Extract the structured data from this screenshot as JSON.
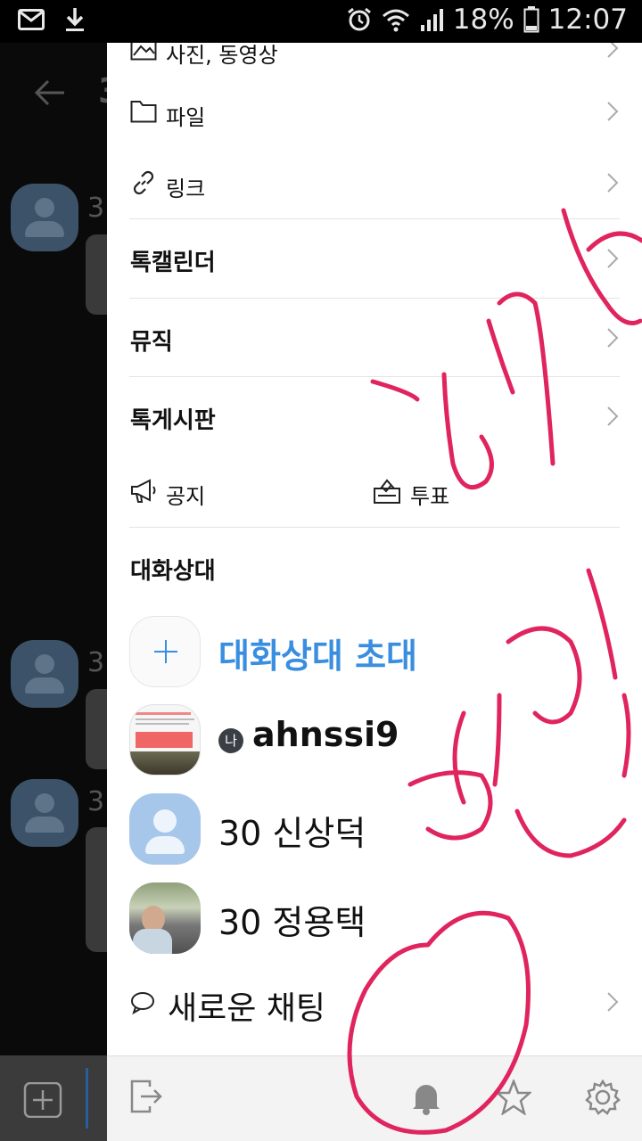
{
  "status_bar": {
    "battery": "18%",
    "time": "12:07"
  },
  "background_chat": {
    "member_count_fragment": "3"
  },
  "drawer": {
    "partial_item": "사진, 동영상",
    "items": [
      {
        "label": "파일"
      },
      {
        "label": "링크"
      }
    ],
    "sections": [
      {
        "label": "톡캘린더"
      },
      {
        "label": "뮤직"
      },
      {
        "label": "톡게시판"
      }
    ],
    "notice_label": "공지",
    "vote_label": "투표",
    "members_title": "대화상대",
    "invite_label": "대화상대 초대",
    "me_badge": "나",
    "members": [
      {
        "name": "ahnssi9"
      },
      {
        "name": "30 신상덕"
      },
      {
        "name": "30 정용택"
      }
    ],
    "new_chat_label": "새로운 채팅"
  },
  "accent_color": "#3a8ee0",
  "annotation_color": "#e0245e"
}
